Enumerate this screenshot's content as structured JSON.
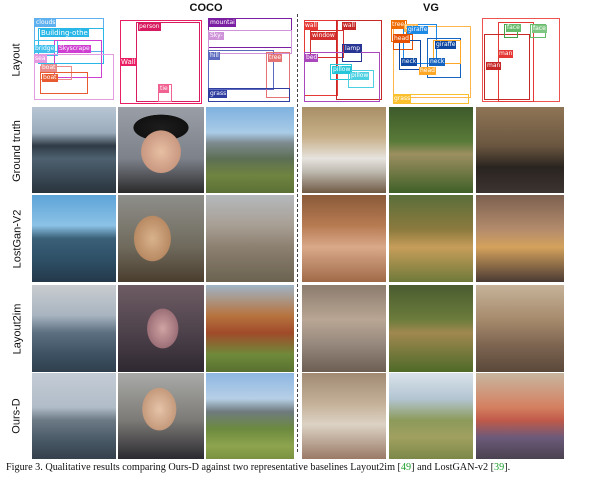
{
  "groups": {
    "coco": "COCO",
    "vg": "VG"
  },
  "rows": [
    "Layout",
    "Ground truth",
    "LostGan-V2",
    "Layout2im",
    "Ours-D"
  ],
  "layouts": [
    {
      "labels": [
        "clouds",
        "Building-othe",
        "bridge",
        "Skyscrape",
        "sea",
        "boat",
        "boat"
      ]
    },
    {
      "labels": [
        "person",
        "Wall",
        "tie"
      ]
    },
    {
      "labels": [
        "mountai",
        "Sky-",
        "hill",
        "tree",
        "grass"
      ]
    },
    {
      "labels": [
        "wall",
        "wall",
        "window",
        "lamp",
        "bed",
        "pillow",
        "pillow"
      ]
    },
    {
      "labels": [
        "tree",
        "tree",
        "giraffe",
        "head",
        "neck",
        "neck",
        "giraffe",
        "head",
        "grass"
      ]
    },
    {
      "labels": [
        "face",
        "face",
        "man",
        "man"
      ]
    }
  ],
  "photos": [
    [
      "city river boats",
      "man sunglasses tie",
      "mountain valley",
      "bedroom",
      "giraffes",
      "two men"
    ],
    [
      "river boats",
      "man phone",
      "rocky hills",
      "bedroom",
      "giraffes",
      "people"
    ],
    [
      "harbor boats",
      "blurry person",
      "hills autumn",
      "bedroom",
      "giraffes",
      "people"
    ],
    [
      "harbor boats",
      "man tie",
      "mountain meadow",
      "bedroom",
      "giraffes",
      "two men"
    ]
  ],
  "caption": {
    "text": "Figure 3. Qualitative results comparing Ours-D against two representative baselines Layout2im [",
    "ref1": "49",
    "mid": "] and LostGAN-v2 [",
    "ref2": "39",
    "end": "]."
  }
}
